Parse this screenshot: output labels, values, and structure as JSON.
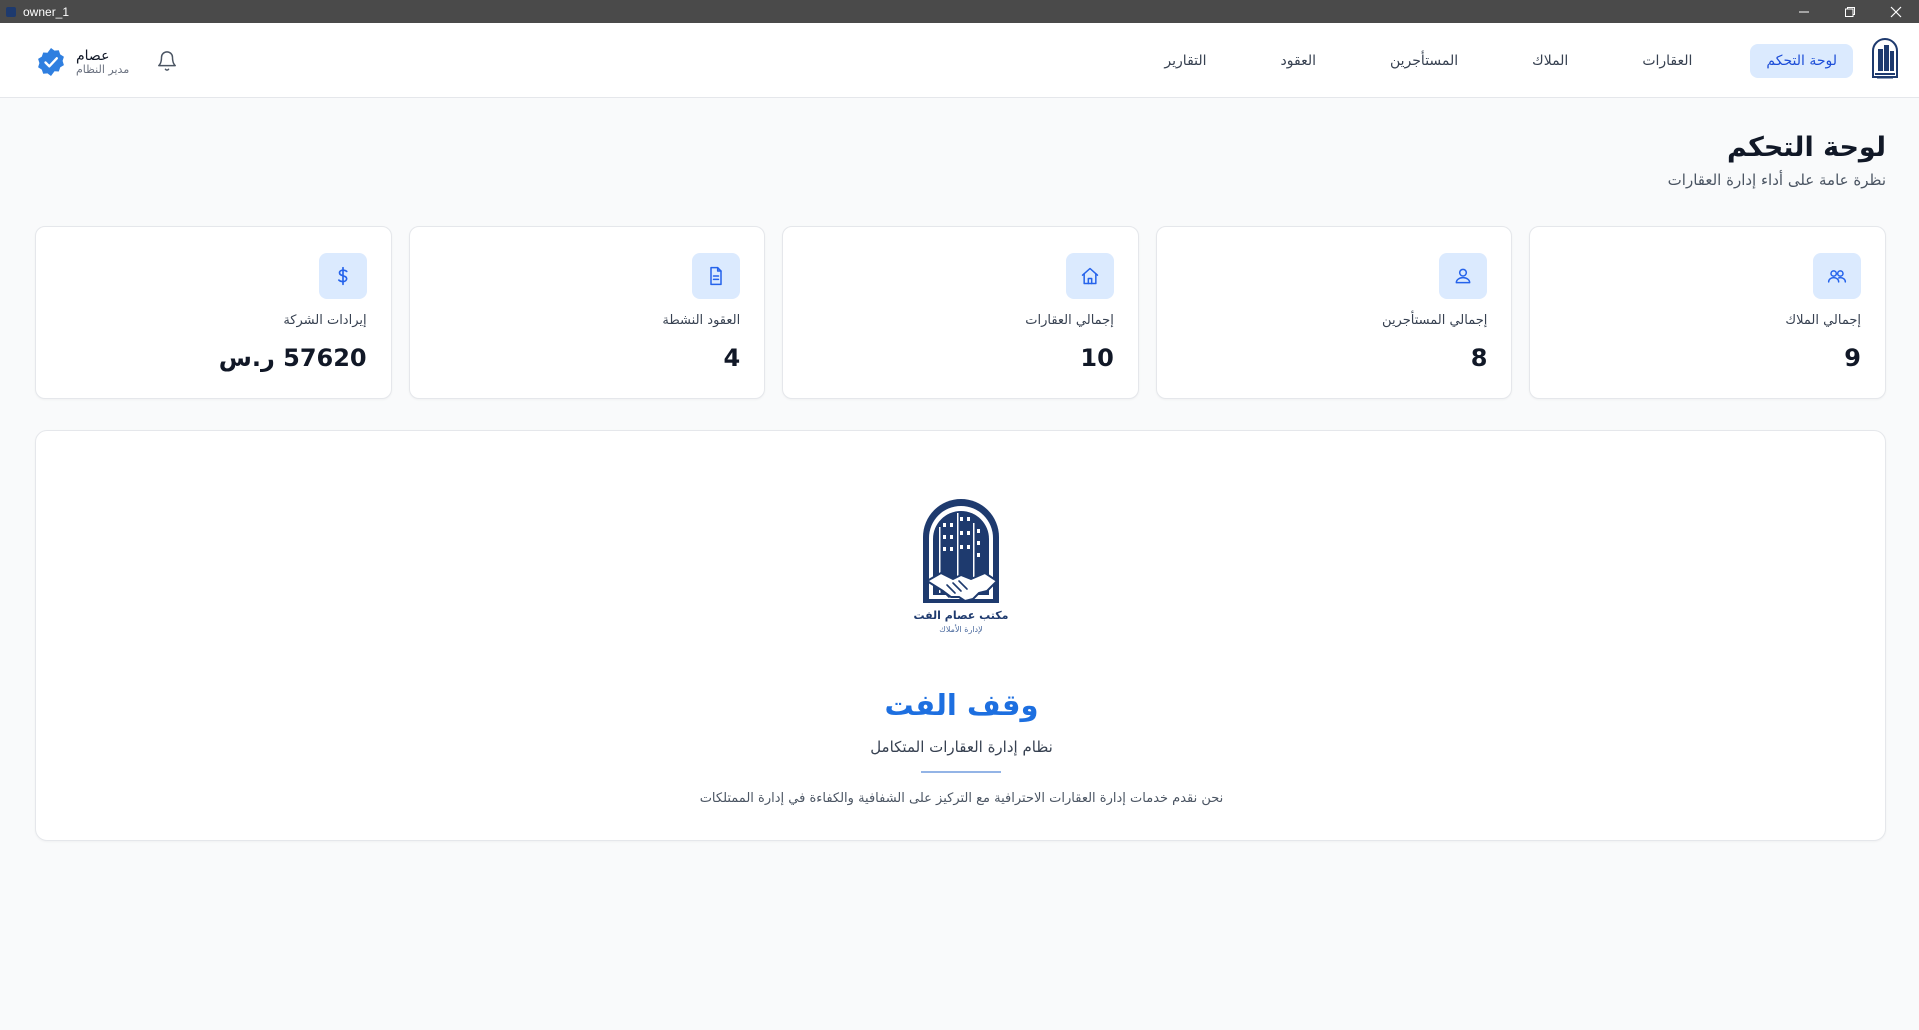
{
  "window": {
    "title": "owner_1"
  },
  "header": {
    "nav": [
      {
        "label": "لوحة التحكم",
        "active": true
      },
      {
        "label": "العقارات",
        "active": false
      },
      {
        "label": "الملاك",
        "active": false
      },
      {
        "label": "المستأجرين",
        "active": false
      },
      {
        "label": "العقود",
        "active": false
      },
      {
        "label": "التقارير",
        "active": false
      }
    ],
    "user": {
      "name": "عصام",
      "role": "مدير النظام"
    }
  },
  "page": {
    "title": "لوحة التحكم",
    "subtitle": "نظرة عامة على أداء إدارة العقارات"
  },
  "stats": [
    {
      "label": "إجمالي الملاك",
      "value": "9",
      "icon": "users-icon"
    },
    {
      "label": "إجمالي المستأجرين",
      "value": "8",
      "icon": "user-icon"
    },
    {
      "label": "إجمالي العقارات",
      "value": "10",
      "icon": "home-icon"
    },
    {
      "label": "العقود النشطة",
      "value": "4",
      "icon": "document-icon"
    },
    {
      "label": "إيرادات الشركة",
      "value": "57620 ر.س",
      "icon": "dollar-icon"
    }
  ],
  "hero": {
    "logo_text": "مكتب عصام الفت",
    "logo_subtext": "لإدارة الأملاك",
    "title": "وقف الفت",
    "subtitle": "نظام إدارة العقارات المتكامل",
    "description": "نحن نقدم خدمات إدارة العقارات الاحترافية مع التركيز على الشفافية والكفاءة في إدارة الممتلكات"
  },
  "colors": {
    "accent": "#2563eb",
    "accent_light": "#dbeafe",
    "hero_title": "#1d6fe0",
    "logo_navy": "#1e3a6e"
  }
}
